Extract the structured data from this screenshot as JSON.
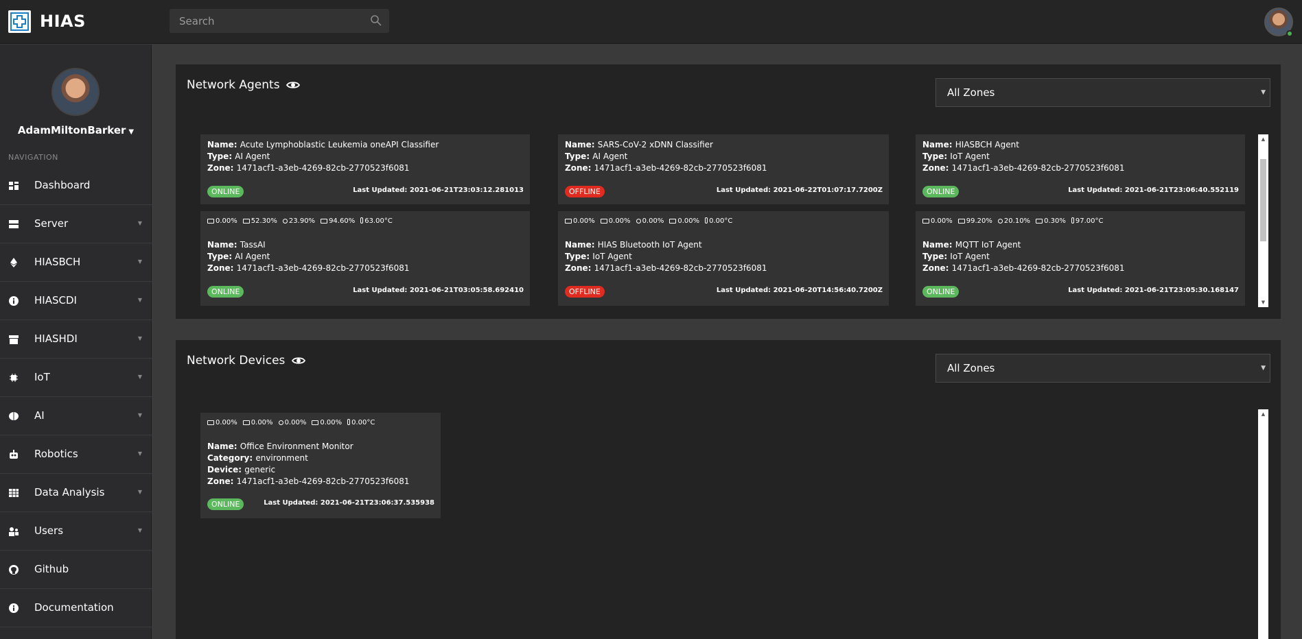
{
  "app": {
    "title": "HIAS"
  },
  "search": {
    "placeholder": "Search"
  },
  "sidebar": {
    "username": "AdamMiltonBarker",
    "nav_heading": "NAVIGATION",
    "items": [
      {
        "label": "Dashboard",
        "icon": "dashboard-icon",
        "has_submenu": false
      },
      {
        "label": "Server",
        "icon": "server-icon",
        "has_submenu": true
      },
      {
        "label": "HIASBCH",
        "icon": "ethereum-icon",
        "has_submenu": true
      },
      {
        "label": "HIASCDI",
        "icon": "info-icon",
        "has_submenu": true
      },
      {
        "label": "HIASHDI",
        "icon": "archive-icon",
        "has_submenu": true
      },
      {
        "label": "IoT",
        "icon": "chip-icon",
        "has_submenu": true
      },
      {
        "label": "AI",
        "icon": "brain-icon",
        "has_submenu": true
      },
      {
        "label": "Robotics",
        "icon": "robot-icon",
        "has_submenu": true
      },
      {
        "label": "Data Analysis",
        "icon": "table-icon",
        "has_submenu": true
      },
      {
        "label": "Users",
        "icon": "users-icon",
        "has_submenu": true
      },
      {
        "label": "Github",
        "icon": "github-icon",
        "has_submenu": false
      },
      {
        "label": "Documentation",
        "icon": "info-icon",
        "has_submenu": false
      }
    ]
  },
  "agents": {
    "title": "Network Agents",
    "zone_filter": "All Zones",
    "cards": [
      {
        "name": "Acute Lymphoblastic Leukemia oneAPI Classifier",
        "type": "AI Agent",
        "zone": "1471acf1-a3eb-4269-82cb-2770523f6081",
        "status": "ONLINE",
        "updated": "2021-06-21T23:03:12.281013",
        "stats": null
      },
      {
        "name": "SARS-CoV-2 xDNN Classifier",
        "type": "AI Agent",
        "zone": "1471acf1-a3eb-4269-82cb-2770523f6081",
        "status": "OFFLINE",
        "updated": "2021-06-22T01:07:17.7200Z",
        "stats": null
      },
      {
        "name": "HIASBCH Agent",
        "type": "IoT Agent",
        "zone": "1471acf1-a3eb-4269-82cb-2770523f6081",
        "status": "ONLINE",
        "updated": "2021-06-21T23:06:40.552119",
        "stats": null
      },
      {
        "name": "TassAI",
        "type": "AI Agent",
        "zone": "1471acf1-a3eb-4269-82cb-2770523f6081",
        "status": "ONLINE",
        "updated": "2021-06-21T03:05:58.692410",
        "stats": {
          "battery": "0.00%",
          "cpu": "52.30%",
          "memory": "23.90%",
          "hdd": "94.60%",
          "temp": "63.00°C"
        }
      },
      {
        "name": "HIAS Bluetooth IoT Agent",
        "type": "IoT Agent",
        "zone": "1471acf1-a3eb-4269-82cb-2770523f6081",
        "status": "OFFLINE",
        "updated": "2021-06-20T14:56:40.7200Z",
        "stats": {
          "battery": "0.00%",
          "cpu": "0.00%",
          "memory": "0.00%",
          "hdd": "0.00%",
          "temp": "0.00°C"
        }
      },
      {
        "name": "MQTT IoT Agent",
        "type": "IoT Agent",
        "zone": "1471acf1-a3eb-4269-82cb-2770523f6081",
        "status": "ONLINE",
        "updated": "2021-06-21T23:05:30.168147",
        "stats": {
          "battery": "0.00%",
          "cpu": "99.20%",
          "memory": "20.10%",
          "hdd": "0.30%",
          "temp": "97.00°C"
        }
      }
    ]
  },
  "devices": {
    "title": "Network Devices",
    "zone_filter": "All Zones",
    "cards": [
      {
        "name": "Office Environment Monitor",
        "category": "environment",
        "device": "generic",
        "zone": "1471acf1-a3eb-4269-82cb-2770523f6081",
        "status": "ONLINE",
        "updated": "2021-06-21T23:06:37.535938",
        "stats": {
          "battery": "0.00%",
          "cpu": "0.00%",
          "memory": "0.00%",
          "hdd": "0.00%",
          "temp": "0.00°C"
        }
      }
    ]
  },
  "labels": {
    "name": "Name:",
    "type": "Type:",
    "zone": "Zone:",
    "category": "Category:",
    "device": "Device:",
    "last_updated": "Last Updated:"
  },
  "colors": {
    "online": "#5cb85c",
    "offline": "#e02b20",
    "panel": "#232323",
    "card": "#333333"
  }
}
